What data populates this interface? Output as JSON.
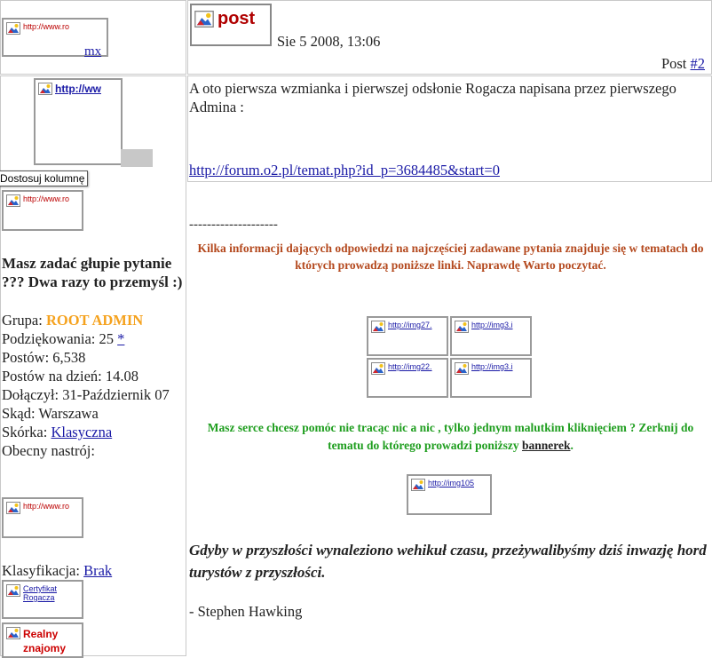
{
  "header": {
    "avatar_alt": "http://www.ro",
    "username": "mx",
    "post_button_alt": "post",
    "date": "Sie 5 2008, 13:06",
    "post_label": "Post ",
    "post_number": "#2"
  },
  "sidebar": {
    "avatar_alt": "http://ww",
    "tooltip": "Dostosuj kolumnę",
    "rank_image_alt": "http://www.ro",
    "signature_title": "Masz zadać głupie pytanie ??? Dwa razy to przemyśl :)",
    "group_label": "Grupa: ",
    "group_value": "ROOT ADMIN",
    "thanks_label": "Podziękowania: 25 ",
    "thanks_link": "*",
    "posts": "Postów: 6,538",
    "posts_per_day": "Postów na dzień: 14.08",
    "joined": "Dołączył: 31-Październik 07",
    "location": "Skąd: Warszawa",
    "skin_label": "Skórka: ",
    "skin_value": "Klasyczna",
    "mood_label": "Obecny nastrój:",
    "mood_image_alt": "http://www.ro",
    "classification_label": "Klasyfikacja: ",
    "classification_value": "Brak",
    "badge1_alt": "Certyfikat Rogacza",
    "badge2_alt": "Realny znajomy"
  },
  "post": {
    "body_text": "A oto pierwsza wzmianka i pierwszej odsłonie Rogacza napisana przez pierwszego Admina :",
    "link": "http://forum.o2.pl/temat.php?id_p=3684485&start=0",
    "separator": "--------------------",
    "info_text": "Kilka informacji dających odpowiedzi na najczęściej zadawane pytania znajduje się w tematach do których prowadzą poniższe linki. Naprawdę Warto poczytać.",
    "grid_images": [
      "http://img27.",
      "http://img3.i",
      "http://img22.",
      "http://img3.i"
    ],
    "green_text": "Masz serce chcesz pomóc nie tracąc nic a nic , tylko jednym malutkim kliknięciem ? Zerknij do tematu do którego prowadzi poniższy ",
    "green_link": "bannerek",
    "green_end": ".",
    "banner_alt": "http://img105",
    "quote": "Gdyby w przyszłości wynaleziono wehikuł czasu, przeżywalibyśmy dziś inwazję hord turystów z przyszłości.",
    "quote_author": "- Stephen Hawking"
  },
  "colors": {
    "accent_orange": "#f5a21e",
    "info_brown": "#b4491e",
    "green": "#1f9e1f",
    "link_blue": "#1a1aa6"
  }
}
